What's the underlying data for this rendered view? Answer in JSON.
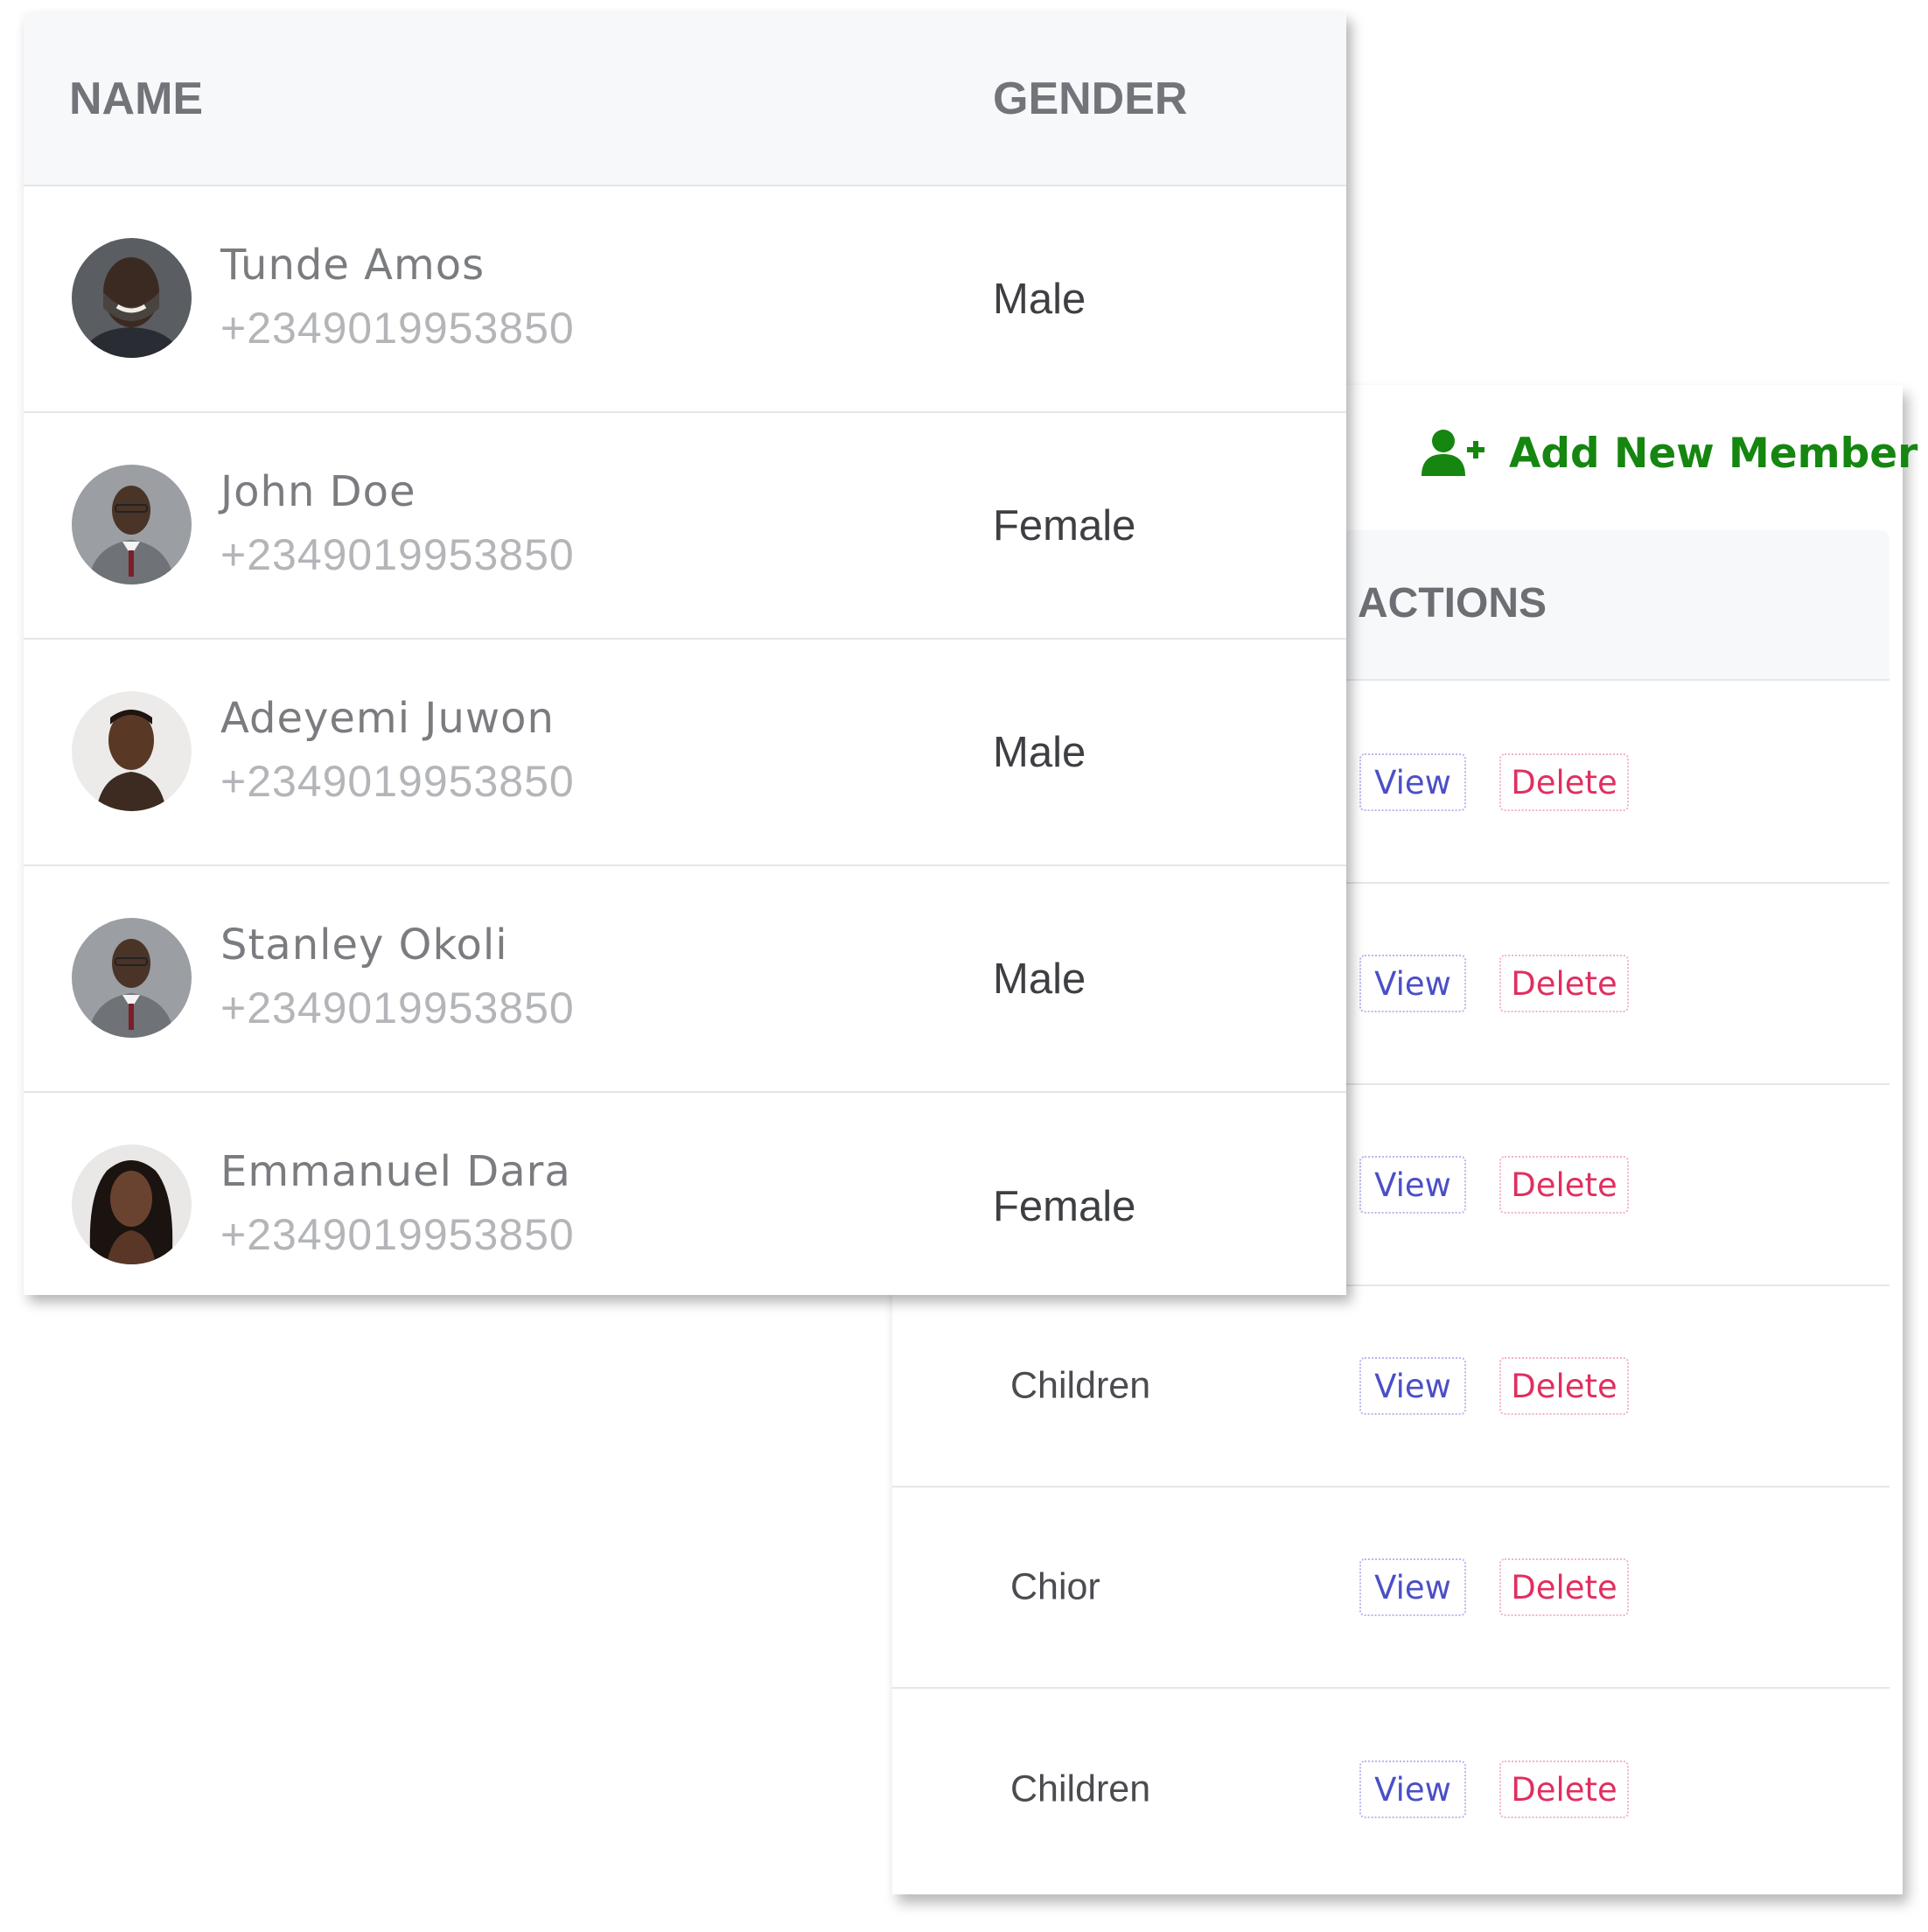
{
  "add_member": {
    "label": "Add New Member",
    "icon": "user-plus-icon",
    "color": "#15860f"
  },
  "members_table": {
    "headers": {
      "name": "NAME",
      "gender": "GENDER"
    },
    "rows": [
      {
        "name": "Tunde Amos",
        "phone": "+2349019953850",
        "gender": "Male"
      },
      {
        "name": "John Doe",
        "phone": "+2349019953850",
        "gender": "Female"
      },
      {
        "name": "Adeyemi Juwon",
        "phone": "+2349019953850",
        "gender": "Male"
      },
      {
        "name": "Stanley Okoli",
        "phone": "+2349019953850",
        "gender": "Male"
      },
      {
        "name": "Emmanuel Dara",
        "phone": "+2349019953850",
        "gender": "Female"
      }
    ]
  },
  "actions_table": {
    "header": "ACTIONS",
    "view_label": "View",
    "delete_label": "Delete",
    "rows": [
      {
        "group": ""
      },
      {
        "group": ""
      },
      {
        "group": ""
      },
      {
        "group": "Children"
      },
      {
        "group": "Chior"
      },
      {
        "group": "Children"
      }
    ]
  },
  "colors": {
    "view": "#4b4fc6",
    "delete": "#e02f5f",
    "header_bg": "#f7f8fa"
  }
}
